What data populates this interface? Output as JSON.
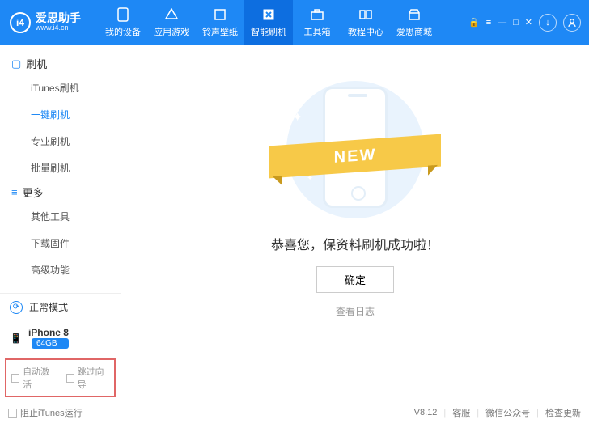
{
  "header": {
    "brand": "爱思助手",
    "url": "www.i4.cn",
    "logo_letters": "i4",
    "nav": [
      {
        "label": "我的设备"
      },
      {
        "label": "应用游戏"
      },
      {
        "label": "铃声壁纸"
      },
      {
        "label": "智能刷机"
      },
      {
        "label": "工具箱"
      },
      {
        "label": "教程中心"
      },
      {
        "label": "爱思商城"
      }
    ]
  },
  "sidebar": {
    "group1": {
      "title": "刷机",
      "items": [
        "iTunes刷机",
        "一键刷机",
        "专业刷机",
        "批量刷机"
      ],
      "active_index": 1
    },
    "group2": {
      "title": "更多",
      "items": [
        "其他工具",
        "下载固件",
        "高级功能"
      ]
    },
    "mode": "正常模式",
    "device_name": "iPhone 8",
    "device_storage": "64GB",
    "checkbox1": "自动激活",
    "checkbox2": "跳过向导"
  },
  "main": {
    "ribbon_text": "NEW",
    "success_text": "恭喜您，保资料刷机成功啦！",
    "ok_button": "确定",
    "view_log": "查看日志"
  },
  "footer": {
    "block_itunes": "阻止iTunes运行",
    "version": "V8.12",
    "support": "客服",
    "wechat": "微信公众号",
    "check_update": "检查更新"
  }
}
